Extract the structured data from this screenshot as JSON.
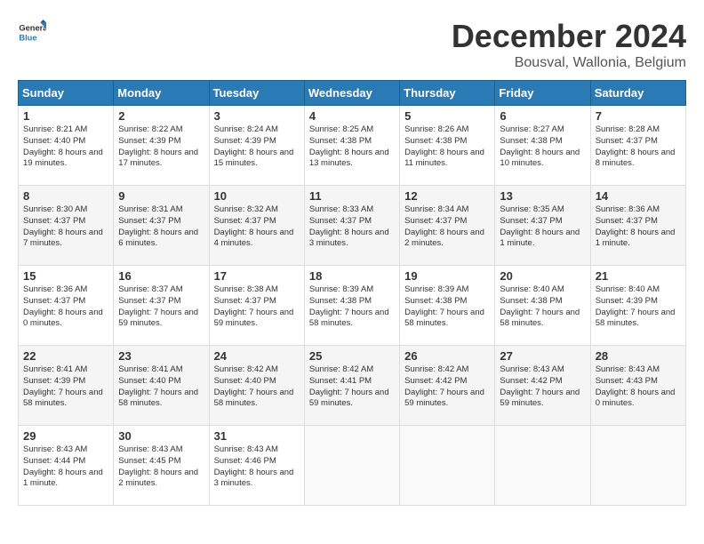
{
  "header": {
    "logo": {
      "general": "General",
      "blue": "Blue"
    },
    "title": "December 2024",
    "location": "Bousval, Wallonia, Belgium"
  },
  "calendar": {
    "days": [
      "Sunday",
      "Monday",
      "Tuesday",
      "Wednesday",
      "Thursday",
      "Friday",
      "Saturday"
    ],
    "weeks": [
      [
        {
          "day": "1",
          "sunrise": "8:21 AM",
          "sunset": "4:40 PM",
          "daylight": "8 hours and 19 minutes."
        },
        {
          "day": "2",
          "sunrise": "8:22 AM",
          "sunset": "4:39 PM",
          "daylight": "8 hours and 17 minutes."
        },
        {
          "day": "3",
          "sunrise": "8:24 AM",
          "sunset": "4:39 PM",
          "daylight": "8 hours and 15 minutes."
        },
        {
          "day": "4",
          "sunrise": "8:25 AM",
          "sunset": "4:38 PM",
          "daylight": "8 hours and 13 minutes."
        },
        {
          "day": "5",
          "sunrise": "8:26 AM",
          "sunset": "4:38 PM",
          "daylight": "8 hours and 11 minutes."
        },
        {
          "day": "6",
          "sunrise": "8:27 AM",
          "sunset": "4:38 PM",
          "daylight": "8 hours and 10 minutes."
        },
        {
          "day": "7",
          "sunrise": "8:28 AM",
          "sunset": "4:37 PM",
          "daylight": "8 hours and 8 minutes."
        }
      ],
      [
        {
          "day": "8",
          "sunrise": "8:30 AM",
          "sunset": "4:37 PM",
          "daylight": "8 hours and 7 minutes."
        },
        {
          "day": "9",
          "sunrise": "8:31 AM",
          "sunset": "4:37 PM",
          "daylight": "8 hours and 6 minutes."
        },
        {
          "day": "10",
          "sunrise": "8:32 AM",
          "sunset": "4:37 PM",
          "daylight": "8 hours and 4 minutes."
        },
        {
          "day": "11",
          "sunrise": "8:33 AM",
          "sunset": "4:37 PM",
          "daylight": "8 hours and 3 minutes."
        },
        {
          "day": "12",
          "sunrise": "8:34 AM",
          "sunset": "4:37 PM",
          "daylight": "8 hours and 2 minutes."
        },
        {
          "day": "13",
          "sunrise": "8:35 AM",
          "sunset": "4:37 PM",
          "daylight": "8 hours and 1 minute."
        },
        {
          "day": "14",
          "sunrise": "8:36 AM",
          "sunset": "4:37 PM",
          "daylight": "8 hours and 1 minute."
        }
      ],
      [
        {
          "day": "15",
          "sunrise": "8:36 AM",
          "sunset": "4:37 PM",
          "daylight": "8 hours and 0 minutes."
        },
        {
          "day": "16",
          "sunrise": "8:37 AM",
          "sunset": "4:37 PM",
          "daylight": "7 hours and 59 minutes."
        },
        {
          "day": "17",
          "sunrise": "8:38 AM",
          "sunset": "4:37 PM",
          "daylight": "7 hours and 59 minutes."
        },
        {
          "day": "18",
          "sunrise": "8:39 AM",
          "sunset": "4:38 PM",
          "daylight": "7 hours and 58 minutes."
        },
        {
          "day": "19",
          "sunrise": "8:39 AM",
          "sunset": "4:38 PM",
          "daylight": "7 hours and 58 minutes."
        },
        {
          "day": "20",
          "sunrise": "8:40 AM",
          "sunset": "4:38 PM",
          "daylight": "7 hours and 58 minutes."
        },
        {
          "day": "21",
          "sunrise": "8:40 AM",
          "sunset": "4:39 PM",
          "daylight": "7 hours and 58 minutes."
        }
      ],
      [
        {
          "day": "22",
          "sunrise": "8:41 AM",
          "sunset": "4:39 PM",
          "daylight": "7 hours and 58 minutes."
        },
        {
          "day": "23",
          "sunrise": "8:41 AM",
          "sunset": "4:40 PM",
          "daylight": "7 hours and 58 minutes."
        },
        {
          "day": "24",
          "sunrise": "8:42 AM",
          "sunset": "4:40 PM",
          "daylight": "7 hours and 58 minutes."
        },
        {
          "day": "25",
          "sunrise": "8:42 AM",
          "sunset": "4:41 PM",
          "daylight": "7 hours and 59 minutes."
        },
        {
          "day": "26",
          "sunrise": "8:42 AM",
          "sunset": "4:42 PM",
          "daylight": "7 hours and 59 minutes."
        },
        {
          "day": "27",
          "sunrise": "8:43 AM",
          "sunset": "4:42 PM",
          "daylight": "7 hours and 59 minutes."
        },
        {
          "day": "28",
          "sunrise": "8:43 AM",
          "sunset": "4:43 PM",
          "daylight": "8 hours and 0 minutes."
        }
      ],
      [
        {
          "day": "29",
          "sunrise": "8:43 AM",
          "sunset": "4:44 PM",
          "daylight": "8 hours and 1 minute."
        },
        {
          "day": "30",
          "sunrise": "8:43 AM",
          "sunset": "4:45 PM",
          "daylight": "8 hours and 2 minutes."
        },
        {
          "day": "31",
          "sunrise": "8:43 AM",
          "sunset": "4:46 PM",
          "daylight": "8 hours and 3 minutes."
        },
        null,
        null,
        null,
        null
      ]
    ],
    "labels": {
      "sunrise": "Sunrise:",
      "sunset": "Sunset:",
      "daylight": "Daylight:"
    }
  }
}
